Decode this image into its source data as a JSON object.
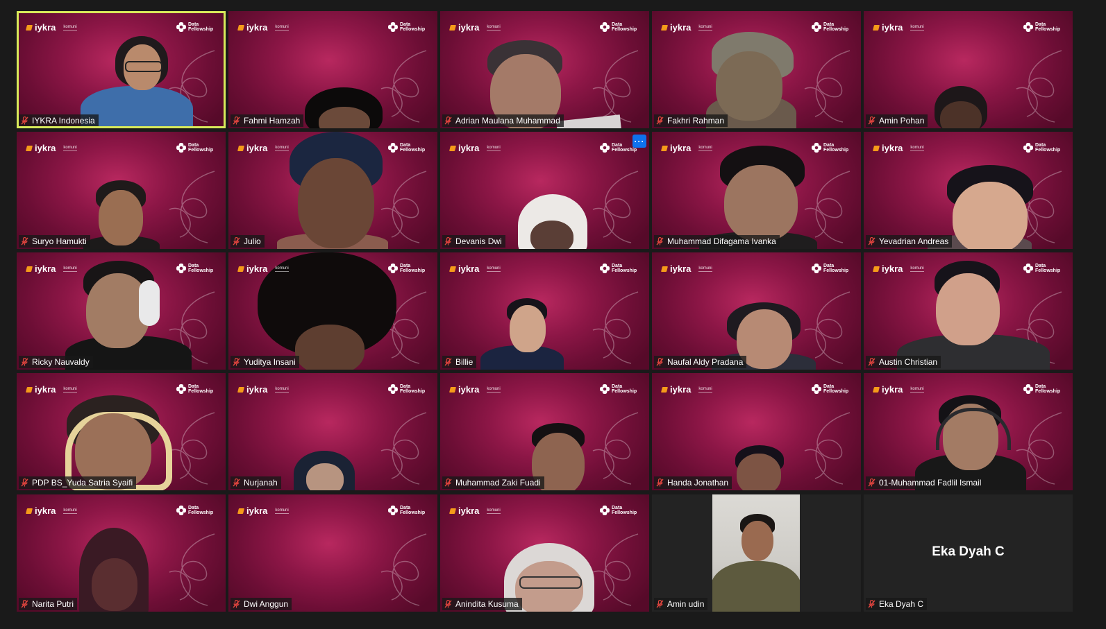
{
  "meeting": {
    "brand_left": "iykra",
    "brand_left_sub": "komuni",
    "brand_right": "Data Fellowship",
    "more_button_label": "···"
  },
  "participants": [
    {
      "name": "IYKRA Indonesia",
      "muted": true,
      "active_speaker": true,
      "bg": "branded"
    },
    {
      "name": "Fahmi Hamzah",
      "muted": true,
      "bg": "branded"
    },
    {
      "name": "Adrian Maulana Muhammad",
      "muted": true,
      "bg": "branded"
    },
    {
      "name": "Fakhri Rahman",
      "muted": true,
      "bg": "branded"
    },
    {
      "name": "Amin Pohan",
      "muted": true,
      "bg": "branded"
    },
    {
      "name": "Suryo Hamukti",
      "muted": true,
      "bg": "branded"
    },
    {
      "name": "Julio",
      "muted": true,
      "bg": "branded"
    },
    {
      "name": "Devanis Dwi",
      "muted": true,
      "bg": "branded",
      "more_menu": true
    },
    {
      "name": "Muhammad Difagama Ivanka",
      "muted": true,
      "bg": "branded"
    },
    {
      "name": "Yevadrian Andreas",
      "muted": true,
      "bg": "branded"
    },
    {
      "name": "Ricky Nauvaldy",
      "muted": true,
      "bg": "branded"
    },
    {
      "name": "Yuditya Insani",
      "muted": true,
      "bg": "branded"
    },
    {
      "name": "Billie",
      "muted": true,
      "bg": "branded"
    },
    {
      "name": "Naufal Aldy Pradana",
      "muted": true,
      "bg": "branded"
    },
    {
      "name": "Austin Christian",
      "muted": true,
      "bg": "branded"
    },
    {
      "name": "PDP BS_Yuda Satria Syaifi",
      "muted": true,
      "bg": "branded"
    },
    {
      "name": "Nurjanah",
      "muted": true,
      "bg": "branded"
    },
    {
      "name": "Muhammad Zaki Fuadi",
      "muted": true,
      "bg": "branded"
    },
    {
      "name": "Handa Jonathan",
      "muted": true,
      "bg": "branded"
    },
    {
      "name": "01-Muhammad Fadlil Ismail",
      "muted": true,
      "bg": "branded"
    },
    {
      "name": "Narita Putri",
      "muted": true,
      "bg": "branded"
    },
    {
      "name": "Dwi Anggun",
      "muted": true,
      "bg": "branded"
    },
    {
      "name": "Anindita Kusuma",
      "muted": true,
      "bg": "branded"
    },
    {
      "name": "Amin udin",
      "muted": true,
      "bg": "camera"
    },
    {
      "name": "Eka Dyah C",
      "muted": true,
      "bg": "video-off",
      "center_name": "Eka Dyah C"
    }
  ],
  "colors": {
    "active_speaker_border": "#d8ea5a",
    "brand_magenta": "#8c1646",
    "mic_off_red": "#e0443e",
    "more_button_blue": "#0e72ed",
    "page_background": "#1a1a1a"
  }
}
